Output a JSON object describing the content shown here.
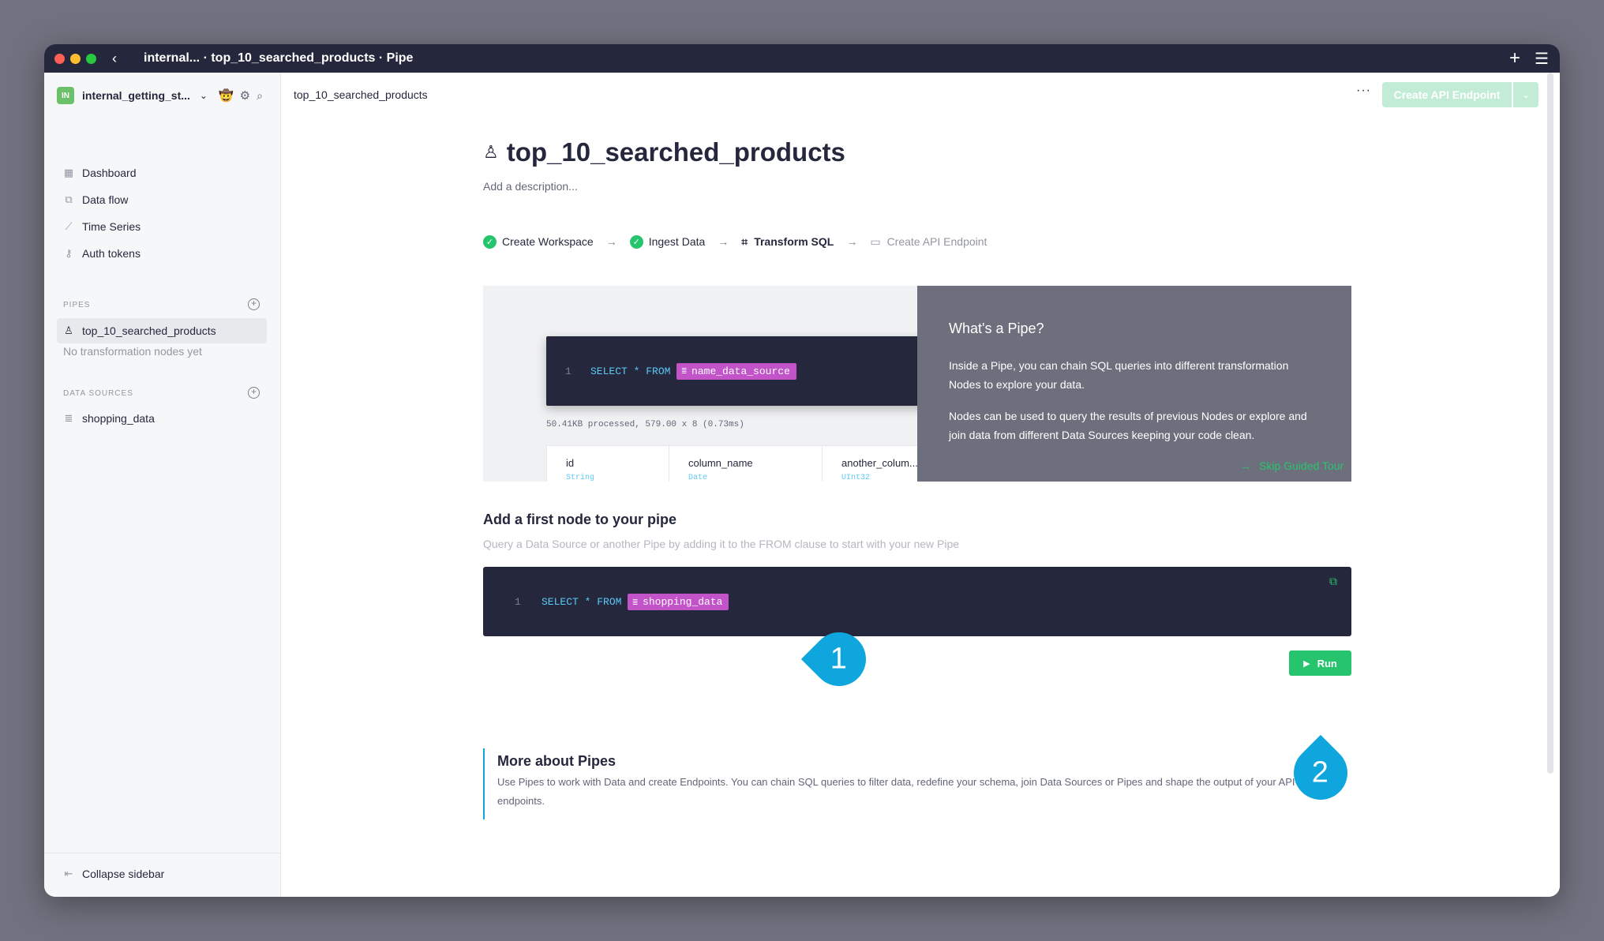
{
  "window": {
    "title": "internal... · top_10_searched_products · Pipe"
  },
  "sidebar": {
    "workspace": {
      "badge": "IN",
      "name": "internal_getting_st...",
      "emoji": "🤠"
    },
    "nav": [
      {
        "label": "Dashboard",
        "icon": "dashboard-icon"
      },
      {
        "label": "Data flow",
        "icon": "data-flow-icon"
      },
      {
        "label": "Time Series",
        "icon": "time-series-icon"
      },
      {
        "label": "Auth tokens",
        "icon": "key-icon"
      }
    ],
    "pipes": {
      "label": "PIPES",
      "items": [
        {
          "label": "top_10_searched_products",
          "icon": "pipe-icon"
        }
      ],
      "empty": "No transformation nodes yet"
    },
    "data_sources": {
      "label": "DATA SOURCES",
      "items": [
        {
          "label": "shopping_data",
          "icon": "database-icon"
        }
      ]
    },
    "collapse_label": "Collapse sidebar"
  },
  "header": {
    "breadcrumb": "top_10_searched_products",
    "more_label": "···",
    "create_button": "Create API Endpoint"
  },
  "pipe": {
    "title": "top_10_searched_products",
    "description_placeholder": "Add a description..."
  },
  "steps": [
    {
      "label": "Create Workspace",
      "state": "done"
    },
    {
      "label": "Ingest Data",
      "state": "done"
    },
    {
      "label": "Transform SQL",
      "state": "active"
    },
    {
      "label": "Create API Endpoint",
      "state": "todo"
    }
  ],
  "tour": {
    "code": {
      "line": "1",
      "keyword": "SELECT * FROM",
      "source": "name_data_source"
    },
    "stats": "50.41KB processed, 579.00 x 8 (0.73ms)",
    "columns": [
      {
        "name": "id",
        "type": "String"
      },
      {
        "name": "column_name",
        "type": "Date"
      },
      {
        "name": "another_colum...",
        "type": "UInt32"
      }
    ],
    "heading": "What's a Pipe?",
    "paragraph1": "Inside a Pipe, you can chain SQL queries into different transformation Nodes to explore your data.",
    "paragraph2": "Nodes can be used to query the results of previous Nodes or explore and join data from different Data Sources keeping your code clean.",
    "skip_label": "Skip Guided Tour"
  },
  "node": {
    "title": "Add a first node to your pipe",
    "description": "Query a Data Source or another Pipe by adding it to the FROM clause to start with your new Pipe",
    "code": {
      "line": "1",
      "keyword": "SELECT * FROM",
      "source": "shopping_data"
    },
    "run_label": "Run"
  },
  "markers": {
    "first": "1",
    "second": "2"
  },
  "more": {
    "title": "More about Pipes",
    "text": "Use Pipes to work with Data and create Endpoints. You can chain SQL queries to filter data, redefine your schema, join Data Sources or Pipes and shape the output of your API endpoints."
  },
  "colors": {
    "accent_green": "#27c46e",
    "marker_blue": "#0fa6dd",
    "code_bg": "#25283d",
    "datasource_pill": "#c253c9"
  }
}
